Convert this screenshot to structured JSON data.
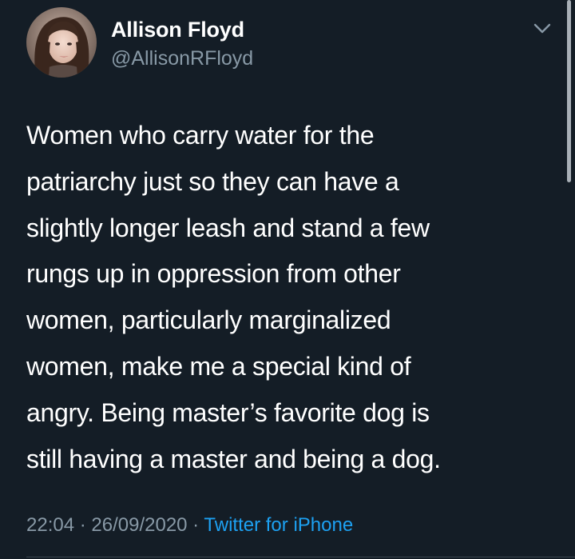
{
  "tweet": {
    "author": {
      "display_name": "Allison Floyd",
      "handle": "@AllisonRFloyd"
    },
    "text_lines": [
      "Women who carry water for the",
      "patriarchy just so they can have a",
      "slightly longer leash and stand a few",
      "rungs up in oppression from other",
      "women, particularly marginalized",
      "women, make me a special kind of",
      "angry. Being master’s favorite dog is",
      "still having a master and being a dog."
    ],
    "meta": {
      "time": "22:04",
      "separator": " · ",
      "date": "26/09/2020",
      "source": "Twitter for iPhone"
    }
  },
  "icons": {
    "menu": "chevron-down-icon",
    "avatar": "profile-photo"
  },
  "colors": {
    "background": "#141d26",
    "text_primary": "#ffffff",
    "text_secondary": "#8899a6",
    "link": "#1da1f2"
  }
}
